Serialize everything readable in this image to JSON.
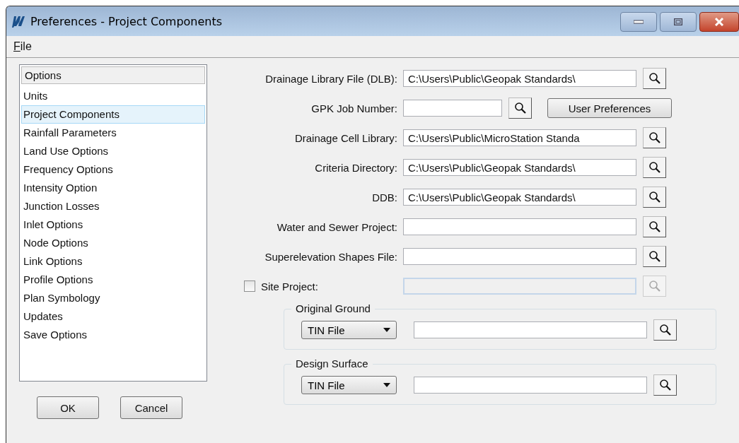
{
  "window": {
    "title": "Preferences - Project Components"
  },
  "menu": [
    {
      "label": "File"
    }
  ],
  "options_list": {
    "header": "Options",
    "items": [
      {
        "label": "Units",
        "selected": false
      },
      {
        "label": "Project Components",
        "selected": true
      },
      {
        "label": "Rainfall Parameters",
        "selected": false
      },
      {
        "label": "Land Use Options",
        "selected": false
      },
      {
        "label": "Frequency Options",
        "selected": false
      },
      {
        "label": "Intensity Option",
        "selected": false
      },
      {
        "label": "Junction Losses",
        "selected": false
      },
      {
        "label": "Inlet Options",
        "selected": false
      },
      {
        "label": "Node Options",
        "selected": false
      },
      {
        "label": "Link Options",
        "selected": false
      },
      {
        "label": "Profile Options",
        "selected": false
      },
      {
        "label": "Plan Symbology",
        "selected": false
      },
      {
        "label": "Updates",
        "selected": false
      },
      {
        "label": "Save Options",
        "selected": false
      }
    ]
  },
  "buttons": [
    "OK",
    "Cancel"
  ],
  "fields": [
    {
      "kind": "path",
      "label": "Drainage Library File (DLB):",
      "value": "C:\\Users\\Public\\Geopak Standards\\"
    },
    {
      "kind": "job",
      "label": "GPK Job Number:",
      "button": "User Preferences"
    },
    {
      "kind": "path",
      "label": "Drainage Cell Library:",
      "value": "C:\\Users\\Public\\MicroStation Standa"
    },
    {
      "kind": "path",
      "label": "Criteria Directory:",
      "value": "C:\\Users\\Public\\Geopak Standards\\"
    },
    {
      "kind": "path",
      "label": "DDB:",
      "value": "C:\\Users\\Public\\Geopak Standards\\"
    },
    {
      "kind": "path",
      "label": "Water and Sewer Project:"
    },
    {
      "kind": "path",
      "label": "Superelevation Shapes File:"
    },
    {
      "kind": "check",
      "label": "Site Project:",
      "checked": false,
      "disabled": true
    }
  ],
  "groups": [
    {
      "legend": "Original Ground",
      "source": "TIN File"
    },
    {
      "legend": "Design Surface",
      "source": "TIN File"
    }
  ]
}
